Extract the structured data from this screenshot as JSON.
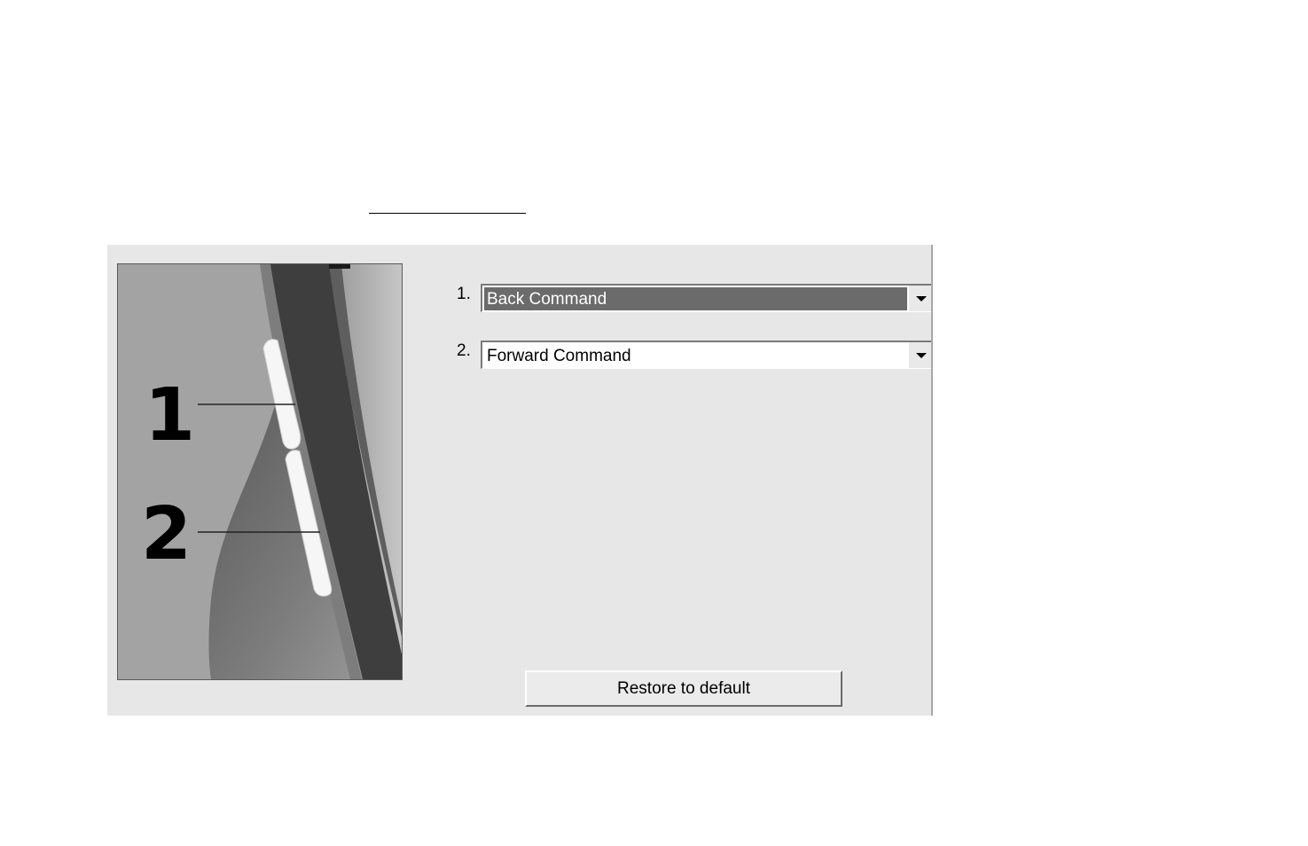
{
  "panel": {
    "illustration": {
      "callout_1": "1",
      "callout_2": "2"
    },
    "commands": [
      {
        "number": "1.",
        "value": "Back Command",
        "selected": true
      },
      {
        "number": "2.",
        "value": "Forward Command",
        "selected": false
      }
    ],
    "restore_button_label": "Restore to default"
  },
  "colors": {
    "panel_background": "#e7e7e7",
    "selection_highlight": "#6b6b6b",
    "illustration_background": "#a3a3a3"
  }
}
